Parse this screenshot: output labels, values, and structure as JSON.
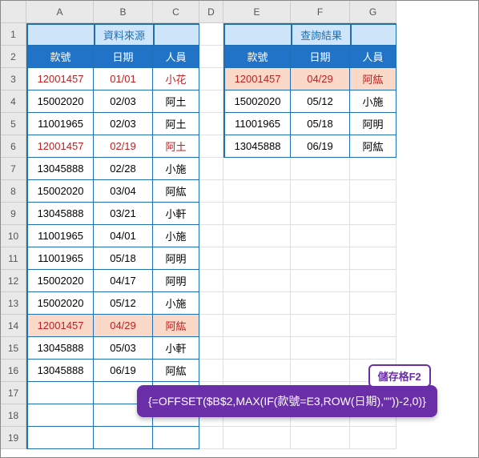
{
  "column_letters": [
    "A",
    "B",
    "C",
    "D",
    "E",
    "F",
    "G"
  ],
  "row_numbers": [
    "1",
    "2",
    "3",
    "4",
    "5",
    "6",
    "7",
    "8",
    "9",
    "10",
    "11",
    "12",
    "13",
    "14",
    "15",
    "16",
    "17",
    "18",
    "19"
  ],
  "source": {
    "title": "資料來源",
    "headers": [
      "款號",
      "日期",
      "人員"
    ],
    "rows": [
      {
        "c": [
          "12001457",
          "01/01",
          "小花"
        ],
        "red": true
      },
      {
        "c": [
          "15002020",
          "02/03",
          "阿土"
        ]
      },
      {
        "c": [
          "11001965",
          "02/03",
          "阿土"
        ]
      },
      {
        "c": [
          "12001457",
          "02/19",
          "阿土"
        ],
        "red": true
      },
      {
        "c": [
          "13045888",
          "02/28",
          "小施"
        ]
      },
      {
        "c": [
          "15002020",
          "03/04",
          "阿紘"
        ]
      },
      {
        "c": [
          "13045888",
          "03/21",
          "小軒"
        ]
      },
      {
        "c": [
          "11001965",
          "04/01",
          "小施"
        ]
      },
      {
        "c": [
          "11001965",
          "05/18",
          "阿明"
        ]
      },
      {
        "c": [
          "15002020",
          "04/17",
          "阿明"
        ]
      },
      {
        "c": [
          "15002020",
          "05/12",
          "小施"
        ]
      },
      {
        "c": [
          "12001457",
          "04/29",
          "阿紘"
        ],
        "red": true,
        "hl": true
      },
      {
        "c": [
          "13045888",
          "05/03",
          "小軒"
        ]
      },
      {
        "c": [
          "13045888",
          "06/19",
          "阿紘"
        ]
      }
    ]
  },
  "result": {
    "title": "查詢結果",
    "headers": [
      "款號",
      "日期",
      "人員"
    ],
    "rows": [
      {
        "c": [
          "12001457",
          "04/29",
          "阿紘"
        ],
        "red": true,
        "hl": true
      },
      {
        "c": [
          "15002020",
          "05/12",
          "小施"
        ]
      },
      {
        "c": [
          "11001965",
          "05/18",
          "阿明"
        ]
      },
      {
        "c": [
          "13045888",
          "06/19",
          "阿紘"
        ]
      }
    ]
  },
  "tooltip": {
    "tag": "儲存格F2",
    "formula": "{=OFFSET($B$2,MAX(IF(款號=E3,ROW(日期),\"\"))-2,0)}"
  }
}
